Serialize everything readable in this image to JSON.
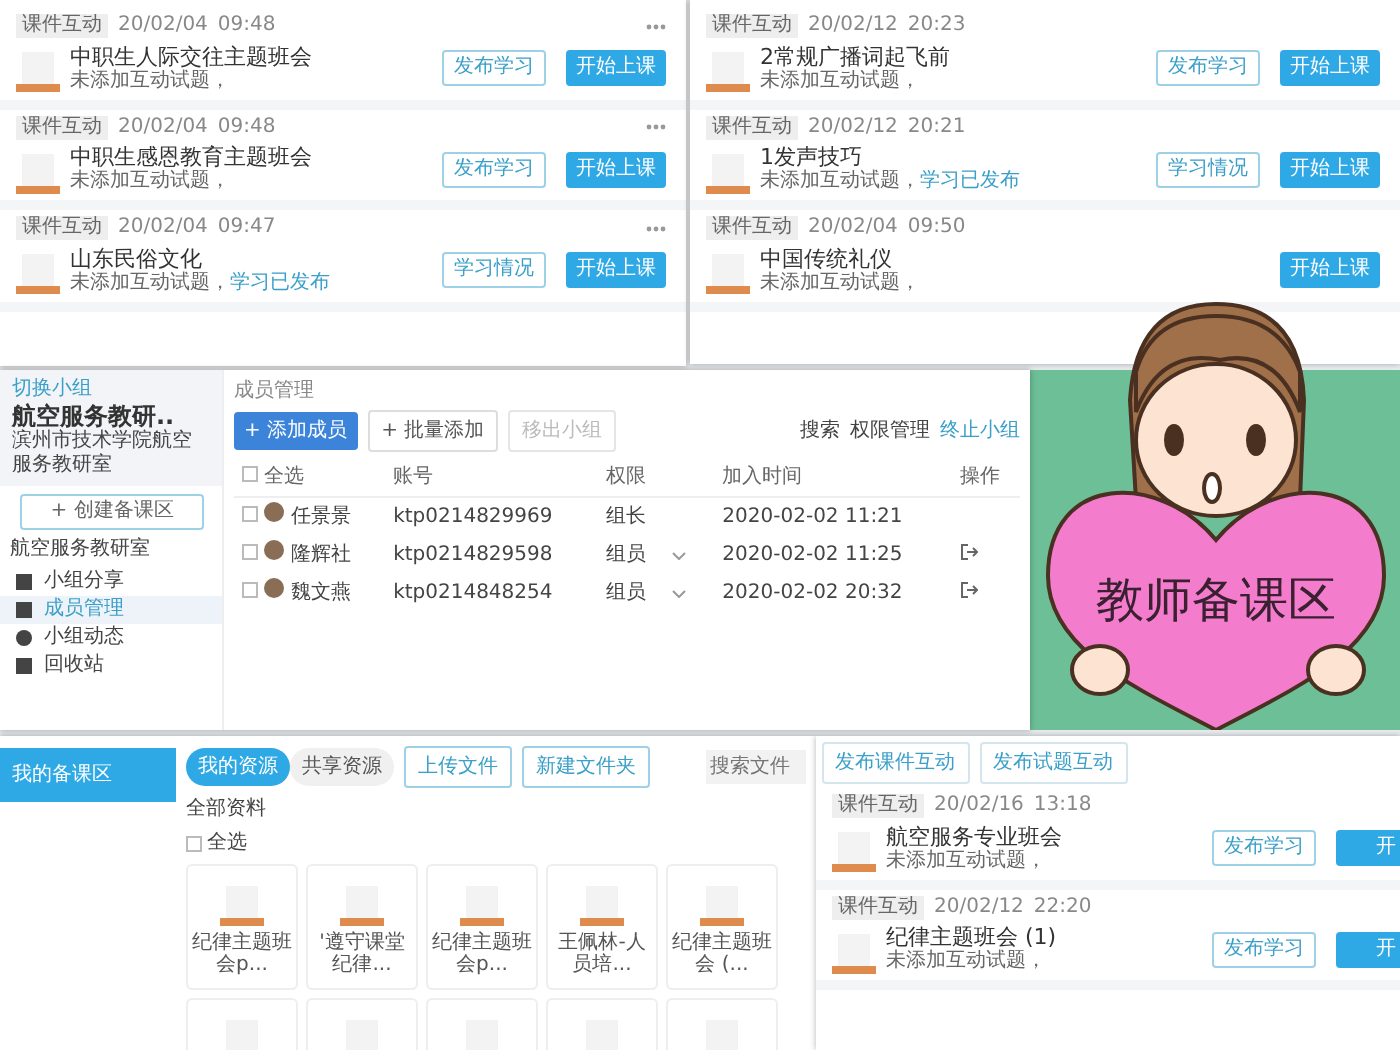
{
  "panel_top_left": {
    "items": [
      {
        "tag": "课件互动",
        "date": "20/02/04",
        "time": "09:48",
        "menu": true,
        "title": "中职生人际交往主题班会",
        "note": "未添加互动试题，",
        "secondary_button": "发布学习",
        "start_button": "开始上课"
      },
      {
        "tag": "课件互动",
        "date": "20/02/04",
        "time": "09:48",
        "menu": true,
        "title": "中职生感恩教育主题班会",
        "note": "未添加互动试题，",
        "secondary_button": "发布学习",
        "start_button": "开始上课"
      },
      {
        "tag": "课件互动",
        "date": "20/02/04",
        "time": "09:47",
        "menu": true,
        "title": "山东民俗文化",
        "note": "未添加互动试题，",
        "status": "学习已发布",
        "secondary_button": "学习情况",
        "start_button": "开始上课"
      }
    ]
  },
  "panel_top_right": {
    "items": [
      {
        "tag": "课件互动",
        "date": "20/02/12",
        "time": "20:23",
        "title": "2常规广播词起飞前",
        "note": "未添加互动试题，",
        "secondary_button": "发布学习",
        "start_button": "开始上课"
      },
      {
        "tag": "课件互动",
        "date": "20/02/12",
        "time": "20:21",
        "title": "1发声技巧",
        "note": "未添加互动试题，",
        "status": "学习已发布",
        "secondary_button": "学习情况",
        "start_button": "开始上课"
      },
      {
        "tag": "课件互动",
        "date": "20/02/04",
        "time": "09:50",
        "title": "中国传统礼仪",
        "note": "未添加互动试题，",
        "start_button": "开始上课"
      }
    ]
  },
  "group_panel": {
    "back_link": "切换小组",
    "group_name": "航空服务教研..",
    "group_org": "滨州市技术学院航空服务教研室",
    "create_button": "+ 创建备课区",
    "section_label": "航空服务教研室",
    "nav": [
      {
        "label": "小组分享",
        "selected": false
      },
      {
        "label": "成员管理",
        "selected": true
      },
      {
        "label": "小组动态",
        "selected": false
      },
      {
        "label": "回收站",
        "selected": false
      }
    ],
    "breadcrumb": "成员管理",
    "add_button": "+ 添加成员",
    "batch_button": "+ 批量添加",
    "remove_button": {
      "label": "移出小组",
      "disabled": true
    },
    "search_link": "搜索",
    "permission_link": "权限管理",
    "stop_link": "终止小组",
    "columns": [
      "全选",
      "账号",
      "权限",
      "加入时间",
      "操作"
    ],
    "select_all_checked": false,
    "rows": [
      {
        "checked": false,
        "name": "任景景",
        "account": "ktp0214829969",
        "role": "组长",
        "joined": "2020-02-02 11:21"
      },
      {
        "checked": false,
        "name": "隆辉社",
        "account": "ktp0214829598",
        "role": "组员",
        "role_menu": true,
        "joined": "2020-02-02 11:25",
        "removable": true
      },
      {
        "checked": false,
        "name": "魏文燕",
        "account": "ktp0214848254",
        "role": "组员",
        "role_menu": true,
        "joined": "2020-02-02 20:32",
        "removable": true
      }
    ]
  },
  "banner": {
    "title": "教师备课区"
  },
  "resources_panel": {
    "sidebar": [
      {
        "label": "我的备课区",
        "selected": true
      }
    ],
    "tabs": [
      {
        "label": "我的资源",
        "selected": true
      },
      {
        "label": "共享资源",
        "selected": false
      }
    ],
    "upload_button": "上传文件",
    "folder_button": "新建文件夹",
    "search": {
      "placeholder": "搜索文件"
    },
    "heading": "全部资料",
    "select_all": {
      "label": "全选",
      "checked": false
    },
    "files": [
      {
        "kind": "ppt",
        "name": "纪律主题班会p..."
      },
      {
        "kind": "ppt",
        "name": "'遵守课堂纪律..."
      },
      {
        "kind": "ppt",
        "name": "纪律主题班会p..."
      },
      {
        "kind": "ppt",
        "name": "王佩林-人员培..."
      },
      {
        "kind": "ppt",
        "name": "纪律主题班会 (..."
      },
      {
        "kind": "ppt"
      },
      {
        "kind": "ppt"
      },
      {
        "kind": "ppt"
      },
      {
        "kind": "ppt"
      },
      {
        "kind": "ppt"
      }
    ]
  },
  "panel_bottom_right": {
    "buttons": [
      "发布课件互动",
      "发布试题互动"
    ],
    "items": [
      {
        "tag": "课件互动",
        "date": "20/02/16",
        "time": "13:18",
        "title": "航空服务专业班会",
        "note": "未添加互动试题，",
        "secondary_button": "发布学习",
        "start_button": "开"
      },
      {
        "tag": "课件互动",
        "date": "20/02/12",
        "time": "22:20",
        "title": "纪律主题班会 (1)",
        "note": "未添加互动试题，",
        "secondary_button": "发布学习",
        "start_button": "开"
      }
    ]
  }
}
